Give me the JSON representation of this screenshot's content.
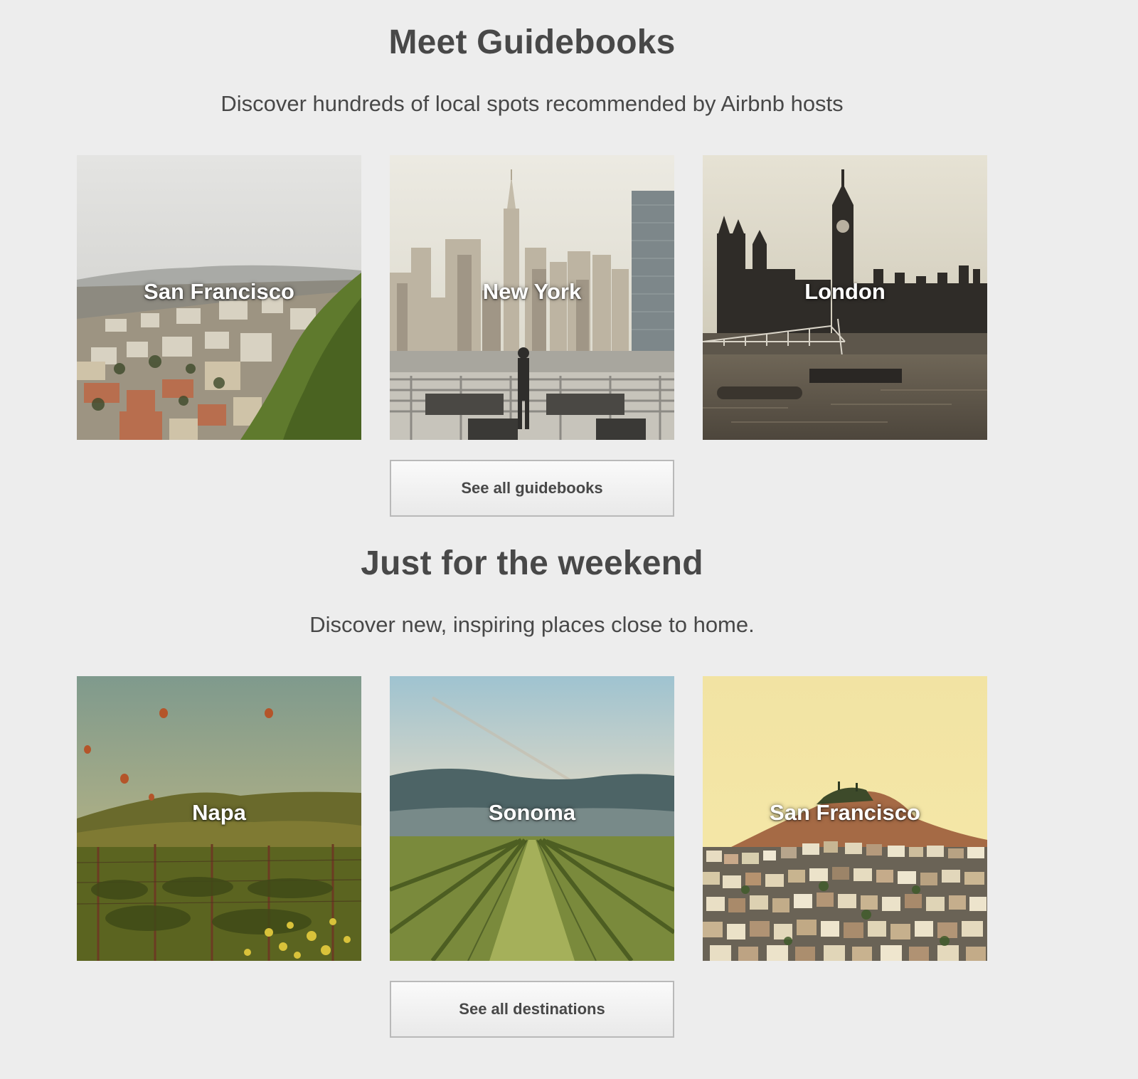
{
  "guidebooks": {
    "title": "Meet Guidebooks",
    "subtitle": "Discover hundreds of local spots recommended by Airbnb hosts",
    "cards": [
      {
        "label": "San Francisco"
      },
      {
        "label": "New York"
      },
      {
        "label": "London"
      }
    ],
    "button_label": "See all guidebooks"
  },
  "weekend": {
    "title": "Just for the weekend",
    "subtitle": "Discover new, inspiring places close to home.",
    "cards": [
      {
        "label": "Napa"
      },
      {
        "label": "Sonoma"
      },
      {
        "label": "San Francisco"
      }
    ],
    "button_label": "See all destinations"
  },
  "colors": {
    "background": "#ededed",
    "text": "#484848",
    "button_border": "#b9b9b9"
  }
}
